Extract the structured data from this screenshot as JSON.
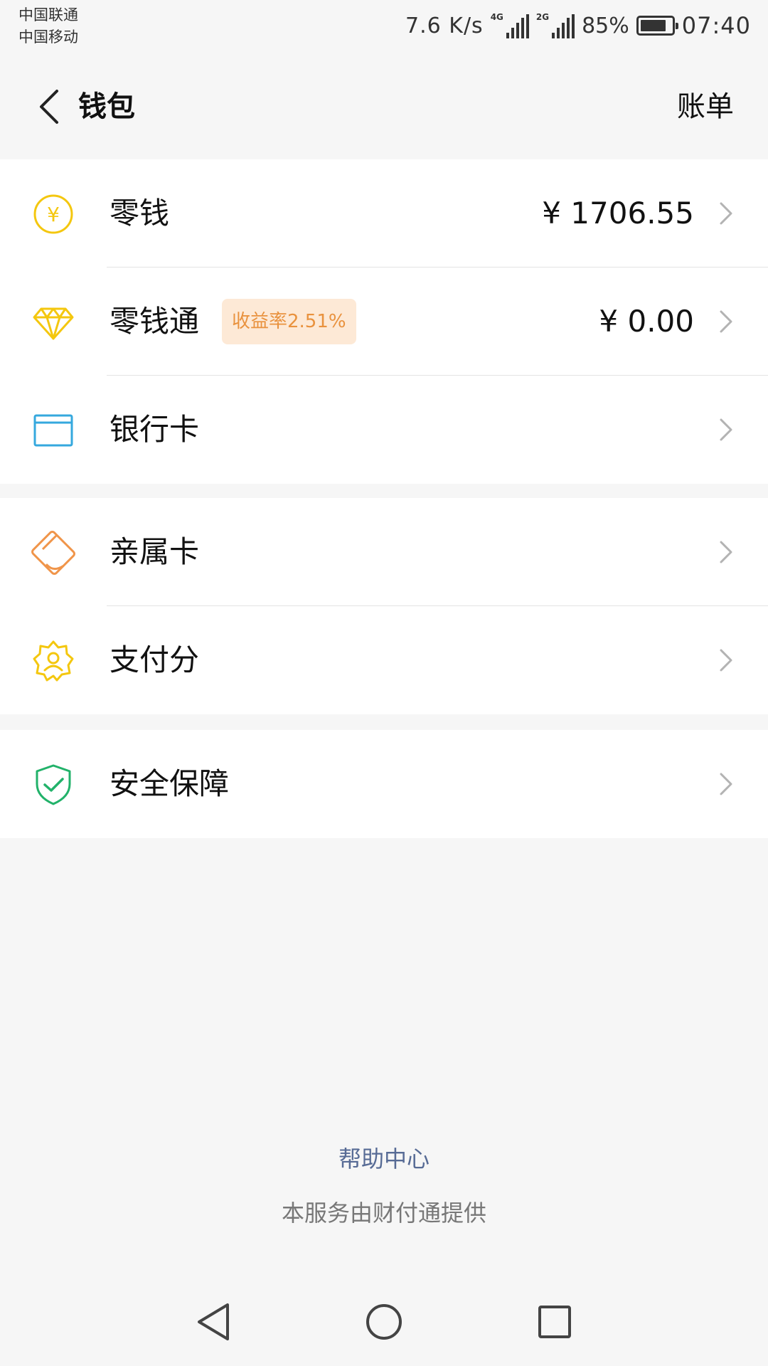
{
  "status_bar": {
    "carrier_1": "中国联通",
    "carrier_2": "中国移动",
    "net_speed": "7.6 K/s",
    "signal_1_tag": "4G",
    "signal_2_tag": "2G",
    "battery_percent": "85%",
    "battery_level": 0.85,
    "time": "07:40"
  },
  "nav": {
    "back_icon": "chevron-left-icon",
    "title": "钱包",
    "right_action": "账单"
  },
  "groups": [
    {
      "rows": [
        {
          "icon": "yuan-coin-icon",
          "label": "零钱",
          "value": "¥ 1706.55"
        },
        {
          "icon": "diamond-icon",
          "label": "零钱通",
          "badge": "收益率2.51%",
          "value": "¥ 0.00"
        },
        {
          "icon": "bank-card-icon",
          "label": "银行卡",
          "value": ""
        }
      ]
    },
    {
      "rows": [
        {
          "icon": "family-card-icon",
          "label": "亲属卡",
          "value": ""
        },
        {
          "icon": "credit-score-icon",
          "label": "支付分",
          "value": ""
        }
      ]
    },
    {
      "rows": [
        {
          "icon": "shield-check-icon",
          "label": "安全保障",
          "value": ""
        }
      ]
    }
  ],
  "footer": {
    "help_center": "帮助中心",
    "provider_note": "本服务由财付通提供"
  },
  "system_nav": {
    "back": "triangle-back-icon",
    "home": "circle-home-icon",
    "recents": "square-recents-icon"
  },
  "colors": {
    "yuan": "#f4c70f",
    "diamond": "#f4c70f",
    "bank_card": "#35a8de",
    "family_card": "#f0954a",
    "credit_score": "#f4c70f",
    "shield": "#22b26a",
    "badge_bg": "#fde9d6",
    "badge_text": "#e9923e",
    "link": "#576b95"
  }
}
